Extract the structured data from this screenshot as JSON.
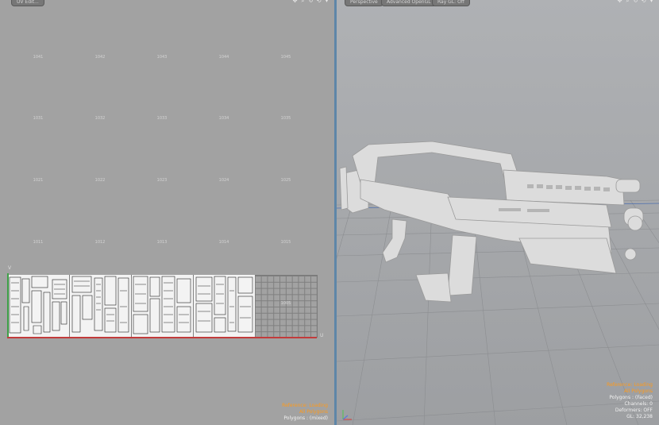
{
  "uv_view": {
    "tab_label": "UV Edit...",
    "icons": [
      "move-icon",
      "zoom-icon",
      "rotate-icon",
      "reset-icon",
      "menu-icon"
    ],
    "tile_rows": [
      [
        "1041",
        "1042",
        "1043",
        "1044",
        "1045"
      ],
      [
        "1031",
        "1032",
        "1033",
        "1034",
        "1035"
      ],
      [
        "1021",
        "1022",
        "1023",
        "1024",
        "1025"
      ],
      [
        "1011",
        "1012",
        "1013",
        "1014",
        "1015"
      ]
    ],
    "empty_tile_label": "1005",
    "u_axis_label": "U",
    "v_axis_label": "V",
    "info": {
      "reference": "Reference: Loading",
      "selection": "All Polygons",
      "polygons": "Polygons : (mixed)"
    }
  },
  "perspective_view": {
    "tabs": [
      "Perspective",
      "Advanced OpenGL",
      "Ray GL: Off"
    ],
    "icons": [
      "move-icon",
      "zoom-icon",
      "rotate-icon",
      "reset-icon",
      "menu-icon"
    ],
    "info": {
      "reference": "Reference: Loading",
      "selection": "All Polygons",
      "polygons": "Polygons : (Faced)",
      "channels": "Channels: 0",
      "deformers": "Deformers: OFF",
      "gl": "GL: 32,238"
    }
  },
  "colors": {
    "accent_info": "#ff9a1a",
    "viewport_divider": "#5e86a8",
    "u_axis": "#c23b3b",
    "v_axis": "#3fa048"
  }
}
